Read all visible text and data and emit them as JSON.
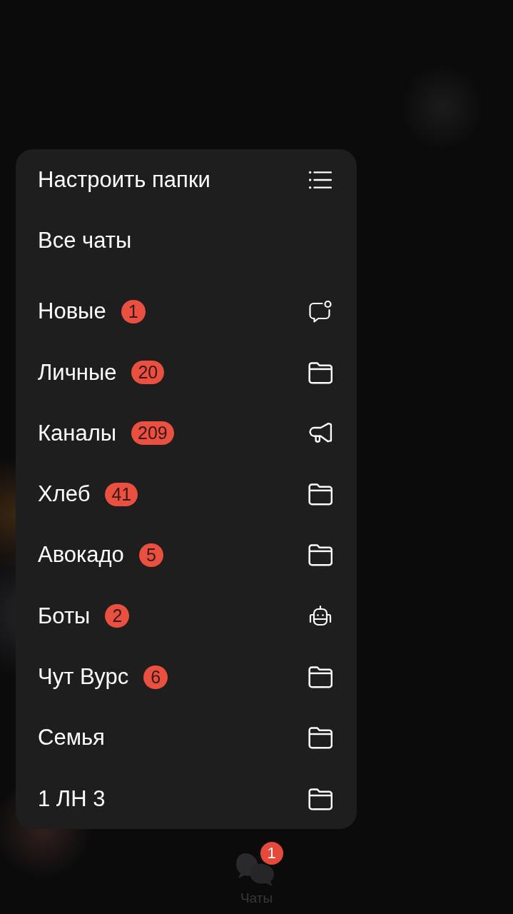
{
  "menu": {
    "sections": [
      {
        "items": [
          {
            "kind": "settings",
            "label": "Настроить папки"
          },
          {
            "kind": "all",
            "label": "Все чаты"
          }
        ]
      },
      {
        "items": [
          {
            "kind": "unread",
            "label": "Новые",
            "badge": "1"
          },
          {
            "kind": "folder",
            "label": "Личные",
            "badge": "20"
          },
          {
            "kind": "channels",
            "label": "Каналы",
            "badge": "209"
          },
          {
            "kind": "folder",
            "label": "Хлеб",
            "badge": "41"
          },
          {
            "kind": "folder",
            "label": "Авокадо",
            "badge": "5"
          },
          {
            "kind": "bots",
            "label": "Боты",
            "badge": "2"
          },
          {
            "kind": "folder",
            "label": "Чут Вурс",
            "badge": "6"
          },
          {
            "kind": "folder",
            "label": "Семья"
          },
          {
            "kind": "folder",
            "label": "1 ЛН 3"
          }
        ]
      }
    ]
  },
  "tab_bar": {
    "tab": {
      "label": "Чаты",
      "badge": "1"
    }
  }
}
